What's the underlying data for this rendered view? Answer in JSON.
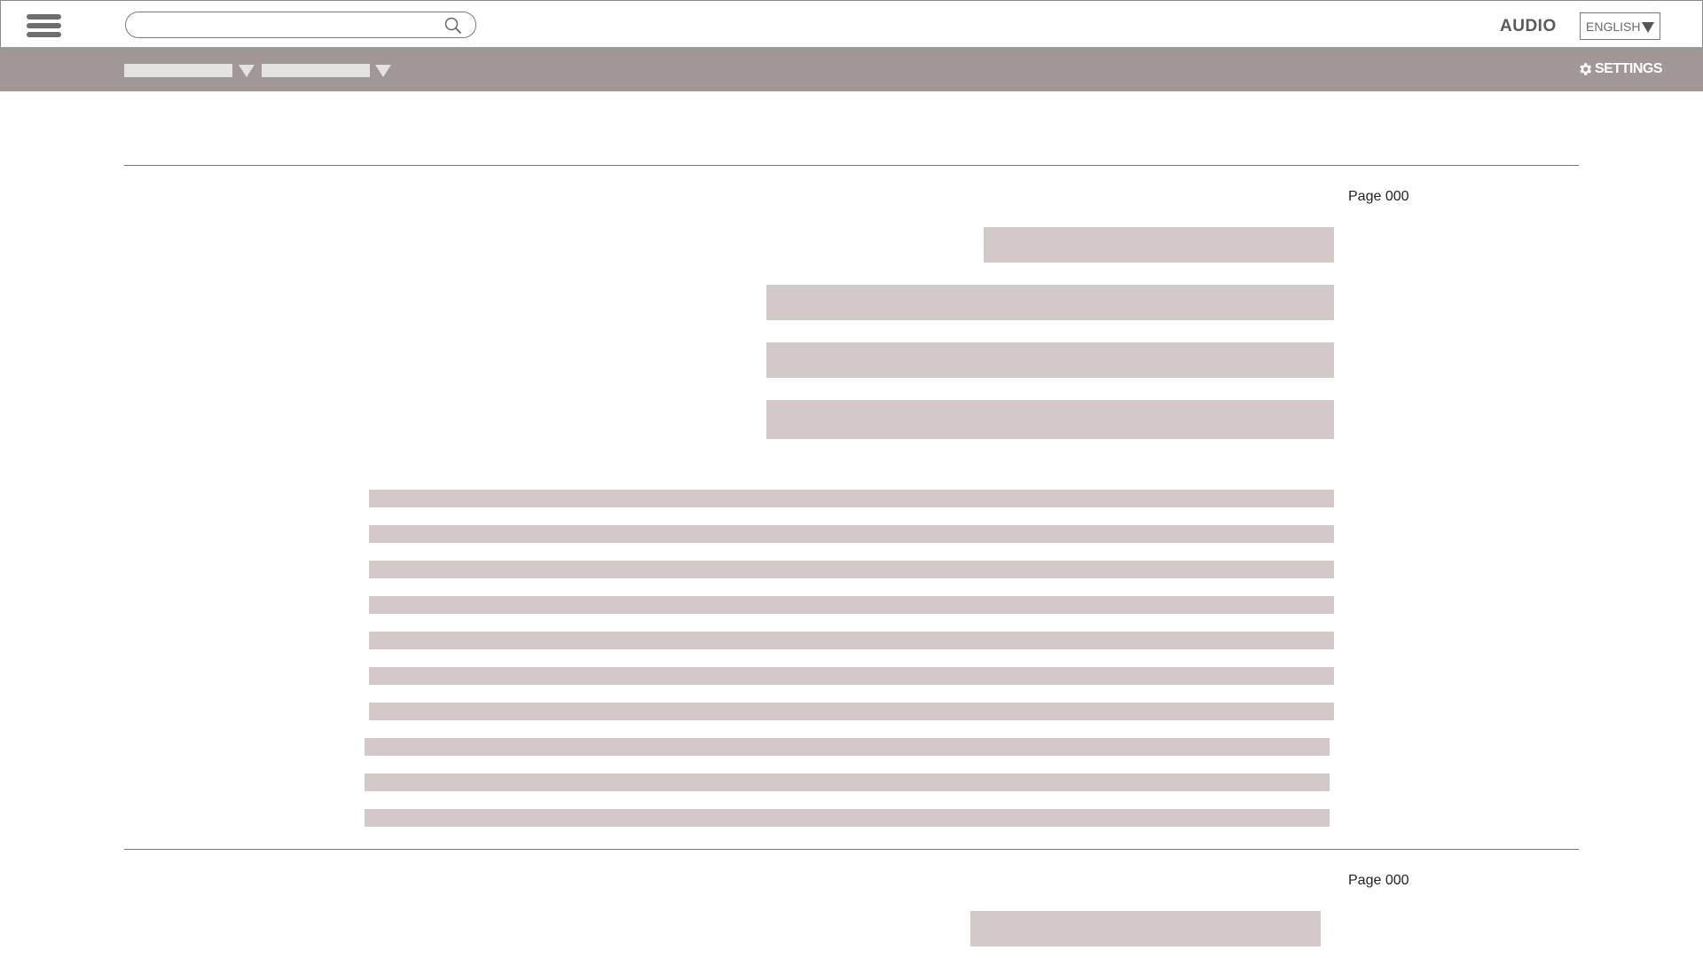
{
  "header": {
    "menu_icon": "hamburger-icon",
    "search": {
      "value": "",
      "placeholder": "",
      "icon": "search-icon"
    },
    "audio_label": "AUDIO",
    "language": {
      "selected": "ENGLISH",
      "icon": "chevron-down-icon"
    }
  },
  "toolbar": {
    "dropdowns": [
      {
        "value": "",
        "icon": "triangle-down-icon"
      },
      {
        "value": "",
        "icon": "triangle-down-icon"
      }
    ],
    "settings_label": "SETTINGS",
    "settings_icon": "gear-icon"
  },
  "pages": [
    {
      "page_label": "Page 000"
    },
    {
      "page_label": "Page 000"
    }
  ],
  "colors": {
    "toolbar_bg": "#a29797",
    "placeholder_block": "#d4c9c9",
    "dropdown_fill": "#e5e2e2"
  }
}
